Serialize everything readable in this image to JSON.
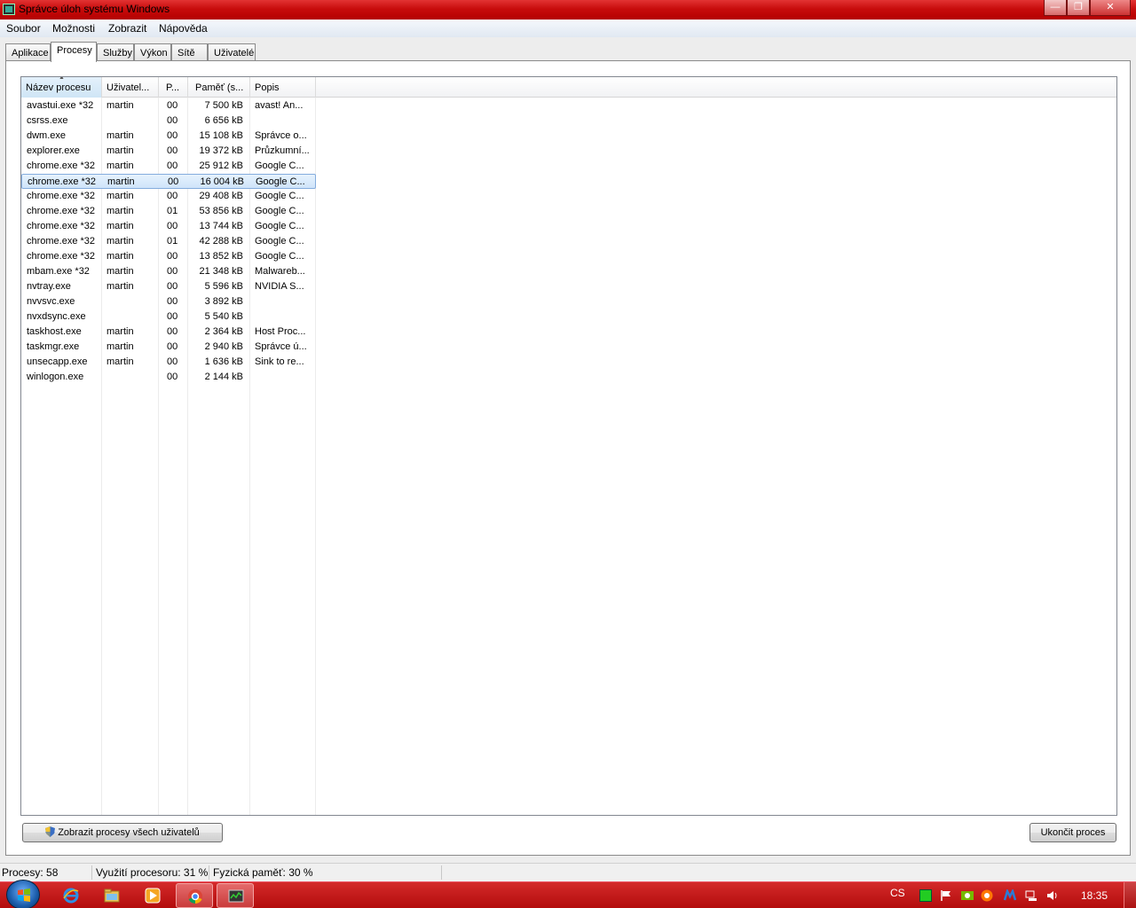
{
  "window": {
    "title": "Správce úloh systému Windows"
  },
  "menu": [
    "Soubor",
    "Možnosti",
    "Zobrazit",
    "Nápověda"
  ],
  "tabs": [
    "Aplikace",
    "Procesy",
    "Služby",
    "Výkon",
    "Sítě",
    "Uživatelé"
  ],
  "active_tab": "Procesy",
  "columns": [
    "Název procesu",
    "Uživatel...",
    "P...",
    "Paměť (s...",
    "Popis"
  ],
  "processes": [
    {
      "name": "avastui.exe *32",
      "user": "martin",
      "cpu": "00",
      "mem": "7 500 kB",
      "desc": "avast! An..."
    },
    {
      "name": "csrss.exe",
      "user": "",
      "cpu": "00",
      "mem": "6 656 kB",
      "desc": ""
    },
    {
      "name": "dwm.exe",
      "user": "martin",
      "cpu": "00",
      "mem": "15 108 kB",
      "desc": "Správce o..."
    },
    {
      "name": "explorer.exe",
      "user": "martin",
      "cpu": "00",
      "mem": "19 372 kB",
      "desc": "Průzkumní..."
    },
    {
      "name": "chrome.exe *32",
      "user": "martin",
      "cpu": "00",
      "mem": "25 912 kB",
      "desc": "Google C..."
    },
    {
      "name": "chrome.exe *32",
      "user": "martin",
      "cpu": "00",
      "mem": "16 004 kB",
      "desc": "Google C...",
      "selected": true
    },
    {
      "name": "chrome.exe *32",
      "user": "martin",
      "cpu": "00",
      "mem": "29 408 kB",
      "desc": "Google C..."
    },
    {
      "name": "chrome.exe *32",
      "user": "martin",
      "cpu": "01",
      "mem": "53 856 kB",
      "desc": "Google C..."
    },
    {
      "name": "chrome.exe *32",
      "user": "martin",
      "cpu": "00",
      "mem": "13 744 kB",
      "desc": "Google C..."
    },
    {
      "name": "chrome.exe *32",
      "user": "martin",
      "cpu": "01",
      "mem": "42 288 kB",
      "desc": "Google C..."
    },
    {
      "name": "chrome.exe *32",
      "user": "martin",
      "cpu": "00",
      "mem": "13 852 kB",
      "desc": "Google C..."
    },
    {
      "name": "mbam.exe *32",
      "user": "martin",
      "cpu": "00",
      "mem": "21 348 kB",
      "desc": "Malwareb..."
    },
    {
      "name": "nvtray.exe",
      "user": "martin",
      "cpu": "00",
      "mem": "5 596 kB",
      "desc": "NVIDIA S..."
    },
    {
      "name": "nvvsvc.exe",
      "user": "",
      "cpu": "00",
      "mem": "3 892 kB",
      "desc": ""
    },
    {
      "name": "nvxdsync.exe",
      "user": "",
      "cpu": "00",
      "mem": "5 540 kB",
      "desc": ""
    },
    {
      "name": "taskhost.exe",
      "user": "martin",
      "cpu": "00",
      "mem": "2 364 kB",
      "desc": "Host Proc..."
    },
    {
      "name": "taskmgr.exe",
      "user": "martin",
      "cpu": "00",
      "mem": "2 940 kB",
      "desc": "Správce ú..."
    },
    {
      "name": "unsecapp.exe",
      "user": "martin",
      "cpu": "00",
      "mem": "1 636 kB",
      "desc": "Sink to re..."
    },
    {
      "name": "winlogon.exe",
      "user": "",
      "cpu": "00",
      "mem": "2 144 kB",
      "desc": ""
    }
  ],
  "buttons": {
    "show_all": "Zobrazit procesy všech uživatelů",
    "end_process": "Ukončit proces"
  },
  "status": {
    "processes": "Procesy: 58",
    "cpu": "Využití procesoru: 31 %",
    "memory": "Fyzická paměť: 30 %"
  },
  "taskbar": {
    "pinned": [
      "internet-explorer-icon",
      "folder-icon",
      "media-player-icon",
      "chrome-icon",
      "task-manager-icon"
    ],
    "language": "CS",
    "clock": "18:35"
  }
}
